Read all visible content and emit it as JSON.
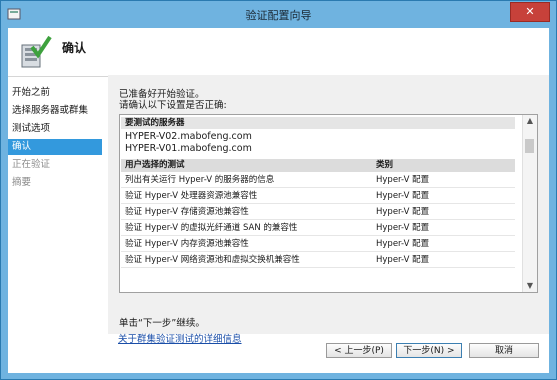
{
  "window": {
    "title": "验证配置向导",
    "close_glyph": "✕"
  },
  "header": {
    "title": "确认",
    "icon": "wizard-check-icon"
  },
  "nav": {
    "items": [
      {
        "label": "开始之前",
        "state": "normal"
      },
      {
        "label": "选择服务器或群集",
        "state": "normal"
      },
      {
        "label": "测试选项",
        "state": "normal"
      },
      {
        "label": "确认",
        "state": "selected"
      },
      {
        "label": "正在验证",
        "state": "disabled"
      },
      {
        "label": "摘要",
        "state": "disabled"
      }
    ]
  },
  "content": {
    "intro_line1": "已准备好开始验证。",
    "intro_line2": "请确认以下设置是否正确:",
    "servers_header": "要测试的服务器",
    "servers": [
      "HYPER-V02.mabofeng.com",
      "HYPER-V01.mabofeng.com"
    ],
    "table": {
      "col1": "用户选择的测试",
      "col2": "类别",
      "rows": [
        {
          "test": "列出有关运行 Hyper-V 的服务器的信息",
          "category": "Hyper-V 配置"
        },
        {
          "test": "验证 Hyper-V 处理器资源池兼容性",
          "category": "Hyper-V 配置"
        },
        {
          "test": "验证 Hyper-V 存储资源池兼容性",
          "category": "Hyper-V 配置"
        },
        {
          "test": "验证 Hyper-V 的虚拟光纤通道 SAN 的兼容性",
          "category": "Hyper-V 配置"
        },
        {
          "test": "验证 Hyper-V 内存资源池兼容性",
          "category": "Hyper-V 配置"
        },
        {
          "test": "验证 Hyper-V 网络资源池和虚拟交换机兼容性",
          "category": "Hyper-V 配置"
        }
      ]
    },
    "next_note": "单击“下一步”继续。",
    "link": "关于群集验证测试的详细信息"
  },
  "buttons": {
    "back": "< 上一步(P)",
    "next": "下一步(N) >",
    "cancel": "取消"
  },
  "colors": {
    "titlebar": "#6fb3e0",
    "selection": "#3399dd",
    "close": "#c7413a",
    "link": "#1a4ea8"
  }
}
